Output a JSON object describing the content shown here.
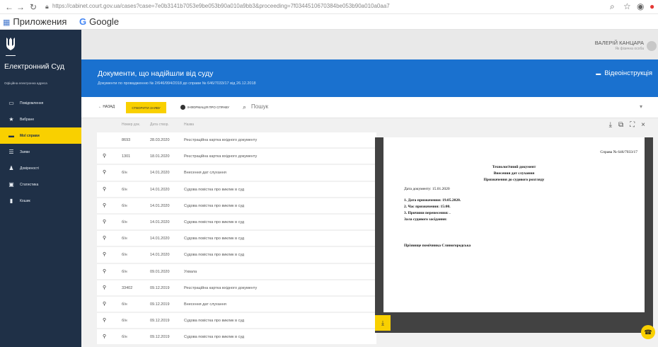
{
  "browser": {
    "url": "https://cabinet.court.gov.ua/cases?case=7e0b3141b7053e9be053b90a010a9bb3&proceeding=7f0344510670384be053b90a010a0aa7",
    "bookmarks": {
      "apps": "Приложения",
      "google": "Google"
    }
  },
  "sidebar": {
    "title": "Електронний Суд",
    "subtitle": "Офіційна електронна адреса",
    "items": [
      {
        "label": "Повідомлення",
        "icon": "message-icon"
      },
      {
        "label": "Вибране",
        "icon": "star-icon"
      },
      {
        "label": "Мої справи",
        "icon": "folder-icon",
        "active": true
      },
      {
        "label": "Заяви",
        "icon": "list-icon"
      },
      {
        "label": "Довіреності",
        "icon": "people-icon"
      },
      {
        "label": "Статистика",
        "icon": "chart-icon"
      },
      {
        "label": "Кошик",
        "icon": "trash-icon"
      }
    ]
  },
  "user": {
    "name": "ВАЛЕРІЙ КАНЦАРА",
    "role": "Як фізична особа"
  },
  "header": {
    "title": "Документи, що надійшли від суду",
    "subtitle": "Документи по провадженню № 2/646/994/2018 до справи № 646/7033/17 від 26.12.2018",
    "video_label": "Відеоінструкція"
  },
  "toolbar": {
    "back_label": "НАЗАД",
    "create_label": "СТВОРИТИ ЗАЯВУ",
    "info_label": "ІНФОРМАЦІЯ ПРО СПРАВУ",
    "search_placeholder": "Пошук"
  },
  "table": {
    "columns": [
      "Номер док.",
      "Дата створ.",
      "Назва"
    ],
    "rows": [
      {
        "attachment": false,
        "number": "8693",
        "date": "28.03.2020",
        "name": "Реєстраційна картка вхідного документу"
      },
      {
        "attachment": true,
        "number": "1301",
        "date": "18.01.2020",
        "name": "Реєстраційна картка вхідного документу"
      },
      {
        "attachment": true,
        "number": "б/н",
        "date": "14.01.2020",
        "name": "Внесення дат слухання"
      },
      {
        "attachment": true,
        "number": "б/н",
        "date": "14.01.2020",
        "name": "Судова повістка про виклик в суд"
      },
      {
        "attachment": true,
        "number": "б/н",
        "date": "14.01.2020",
        "name": "Судова повістка про виклик в суд"
      },
      {
        "attachment": true,
        "number": "б/н",
        "date": "14.01.2020",
        "name": "Судова повістка про виклик в суд"
      },
      {
        "attachment": true,
        "number": "б/н",
        "date": "14.01.2020",
        "name": "Судова повістка про виклик в суд"
      },
      {
        "attachment": true,
        "number": "б/н",
        "date": "14.01.2020",
        "name": "Судова повістка про виклик в суд"
      },
      {
        "attachment": true,
        "number": "б/н",
        "date": "09.01.2020",
        "name": "Ухвала"
      },
      {
        "attachment": true,
        "number": "33402",
        "date": "09.12.2019",
        "name": "Реєстраційна картка вхідного документу"
      },
      {
        "attachment": true,
        "number": "б/н",
        "date": "09.12.2019",
        "name": "Внесення дат слухання"
      },
      {
        "attachment": true,
        "number": "б/н",
        "date": "09.12.2019",
        "name": "Судова повістка про виклик в суд"
      },
      {
        "attachment": true,
        "number": "б/н",
        "date": "09.12.2019",
        "name": "Судова повістка про виклик в суд"
      }
    ]
  },
  "preview": {
    "case_number": "Справа № 646/7033/17",
    "doc_title_1": "Технологічний документ",
    "doc_title_2": "Внесення дат слухання",
    "doc_title_3": "Призначення до судового розгляду",
    "doc_date": "Дата документу: 15.01.2020",
    "line_1": "1. Дата призначення: 19.05.2020.",
    "line_2": "2. Час призначення: 15:00.",
    "line_3": "3. Причини перенесення: .",
    "line_4": "Зала судового засідання:",
    "signature": "Прізвище помічника Слиногородська"
  },
  "colors": {
    "accent": "#f9d000",
    "header_blue": "#1a71cf",
    "sidebar": "#1f3047"
  }
}
